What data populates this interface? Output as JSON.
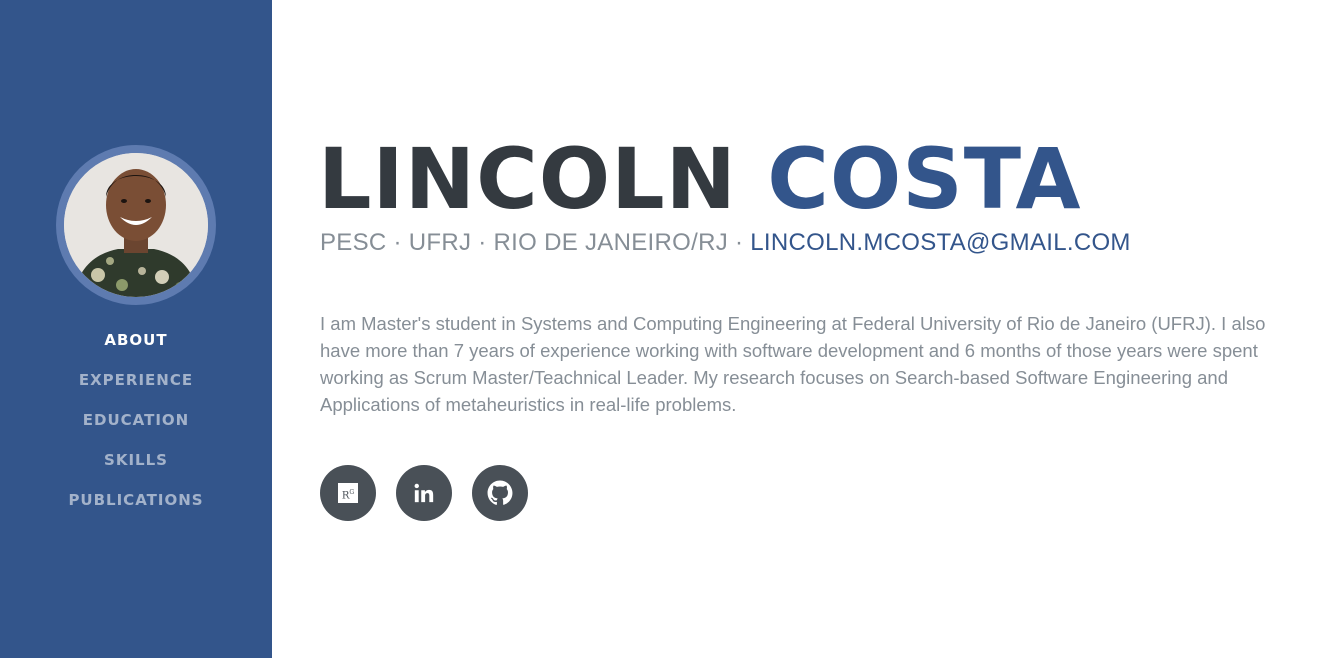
{
  "sidebar": {
    "nav": [
      {
        "label": "ABOUT",
        "active": true
      },
      {
        "label": "EXPERIENCE",
        "active": false
      },
      {
        "label": "EDUCATION",
        "active": false
      },
      {
        "label": "SKILLS",
        "active": false
      },
      {
        "label": "PUBLICATIONS",
        "active": false
      }
    ]
  },
  "header": {
    "first_name": "LINCOLN",
    "last_name": "COSTA",
    "subheading": "PESC · UFRJ · RIO DE JANEIRO/RJ · ",
    "email": "LINCOLN.MCOSTA@GMAIL.COM"
  },
  "bio": "I am Master's student in Systems and Computing Engineering at Federal University of Rio de Janeiro (UFRJ). I also have more than 7 years of experience working with software development and 6 months of those years were spent working as Scrum Master/Teachnical Leader. My research focuses on Search-based Software Engineering and Applications of metaheuristics in real-life problems.",
  "social": [
    {
      "icon": "researchgate-icon",
      "glyph": "R",
      "glyph_sup": "G"
    },
    {
      "icon": "linkedin-icon"
    },
    {
      "icon": "github-icon"
    }
  ],
  "colors": {
    "primary": "#33558b",
    "dark": "#343a40",
    "muted": "#868e96",
    "social_bg": "#495057"
  }
}
